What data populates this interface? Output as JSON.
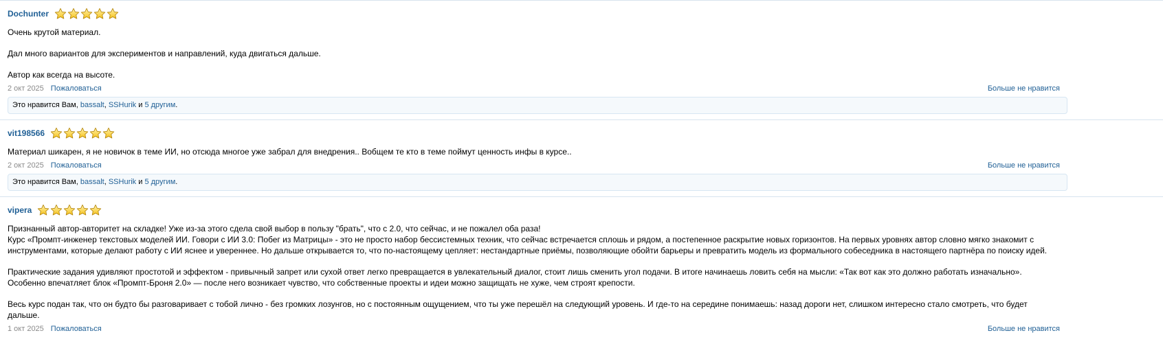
{
  "icons": {
    "star": "star-icon",
    "star_fill": "#f6c21a",
    "star_stroke": "#b88a12"
  },
  "colors": {
    "link": "#1f5f95",
    "date": "#8a8a8a",
    "likes_bg": "#f5f9fc",
    "divider": "#d7e3ee"
  },
  "reviews": [
    {
      "username": "Dochunter",
      "rating": 5,
      "paragraphs": [
        [
          "Очень крутой материал."
        ],
        [
          "Дал много вариантов для экспериментов и направлений, куда двигаться дальше."
        ],
        [
          "Автор как всегда на высоте."
        ]
      ],
      "date": "2 окт 2025",
      "report_label": "Пожаловаться",
      "unlike_label": "Больше не нравится",
      "likes": {
        "prefix": "Это нравится Вам, ",
        "user1": "bassalt",
        "sep": ", ",
        "user2": "SSHurik",
        "and": " и ",
        "others": "5 другим",
        "end": "."
      }
    },
    {
      "username": "vit198566",
      "rating": 5,
      "paragraphs": [
        [
          "Материал шикарен, я не новичок в теме ИИ, но отсюда многое уже забрал для внедрения.. Вобщем те кто в теме поймут ценность инфы в курсе.."
        ]
      ],
      "date": "2 окт 2025",
      "report_label": "Пожаловаться",
      "unlike_label": "Больше не нравится",
      "likes": {
        "prefix": "Это нравится Вам, ",
        "user1": "bassalt",
        "sep": ", ",
        "user2": "SSHurik",
        "and": " и ",
        "others": "5 другим",
        "end": "."
      }
    },
    {
      "username": "vipera",
      "rating": 5,
      "paragraphs": [
        [
          "Признанный автор-авторитет на складке! Уже из-за этого сдела свой выбор в пользу \"брать\", что с 2.0, что сейчас, и не пожалел оба раза!",
          "Курс «Промпт-инженер текстовых моделей ИИ. Говори с ИИ 3.0: Побег из Матрицы» - это не просто набор бессистемных техник, что сейчас встречается сплошь и рядом, а постепенное раскрытие новых горизонтов. На первых уровнях автор словно мягко знакомит с инструментами, которые делают работу с ИИ яснее и увереннее. Но дальше открывается то, что по-настоящему цепляет: нестандартные приёмы, позволяющие обойти барьеры и превратить модель из формального собеседника в настоящего партнёра по поиску идей."
        ],
        [
          "Практические задания удивляют простотой и эффектом - привычный запрет или сухой ответ легко превращается в увлекательный диалог, стоит лишь сменить угол подачи. В итоге начинаешь ловить себя на мысли: «Так вот как это должно работать изначально». Особенно впечатляет блок «Промпт-Броня 2.0» — после него возникает чувство, что собственные проекты и идеи можно защищать не хуже, чем строят крепости."
        ],
        [
          "Весь курс подан так, что он будто бы разговаривает с тобой лично - без громких лозунгов, но с постоянным ощущением, что ты уже перешёл на следующий уровень. И где-то на середине понимаешь: назад дороги нет, слишком интересно стало смотреть, что будет дальше."
        ]
      ],
      "date": "1 окт 2025",
      "report_label": "Пожаловаться",
      "unlike_label": "Больше не нравится",
      "likes": null
    }
  ]
}
